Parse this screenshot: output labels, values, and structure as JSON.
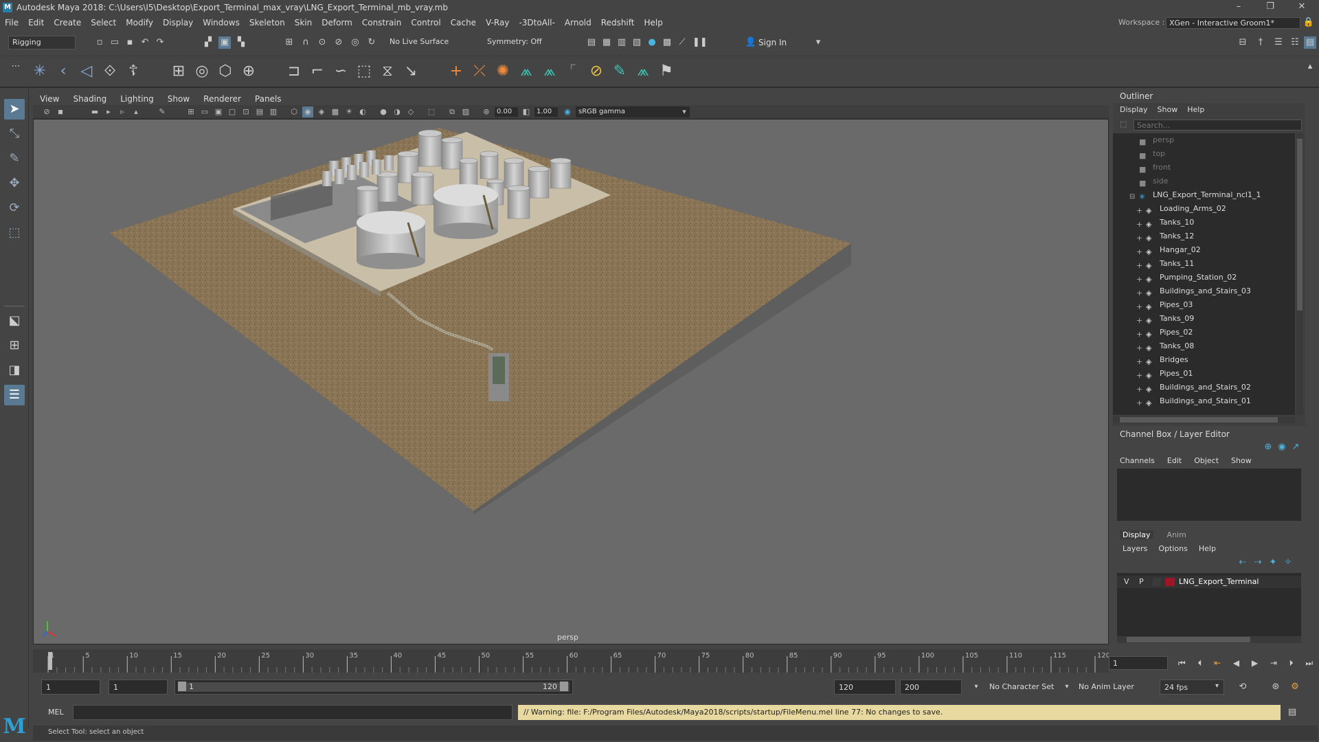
{
  "window": {
    "title": "Autodesk Maya 2018: C:\\Users\\I5\\Desktop\\Export_Terminal_max_vray\\LNG_Export_Terminal_mb_vray.mb"
  },
  "menubar": [
    "File",
    "Edit",
    "Create",
    "Select",
    "Modify",
    "Display",
    "Windows",
    "Skeleton",
    "Skin",
    "Deform",
    "Constrain",
    "Control",
    "Cache",
    "V-Ray",
    "-3DtoAll-",
    "Arnold",
    "Redshift",
    "Help"
  ],
  "workspace": {
    "label": "Workspace :",
    "value": "XGen - Interactive Groom1*"
  },
  "statusline": {
    "menuset": "Rigging",
    "live_surface": "No Live Surface",
    "symmetry": "Symmetry: Off",
    "sign_in": "Sign In"
  },
  "panel": {
    "menus": [
      "View",
      "Shading",
      "Lighting",
      "Show",
      "Renderer",
      "Panels"
    ],
    "exposure": "0.00",
    "gamma": "1.00",
    "colorspace": "sRGB gamma",
    "camera_label": "persp"
  },
  "outliner": {
    "title": "Outliner",
    "menus": [
      "Display",
      "Show",
      "Help"
    ],
    "search_placeholder": "Search...",
    "cameras": [
      "persp",
      "top",
      "front",
      "side"
    ],
    "root": "LNG_Export_Terminal_ncl1_1",
    "children": [
      "Loading_Arms_02",
      "Tanks_10",
      "Tanks_12",
      "Hangar_02",
      "Tanks_11",
      "Pumping_Station_02",
      "Buildings_and_Stairs_03",
      "Pipes_03",
      "Tanks_09",
      "Pipes_02",
      "Tanks_08",
      "Bridges",
      "Pipes_01",
      "Buildings_and_Stairs_02",
      "Buildings_and_Stairs_01"
    ]
  },
  "channelbox": {
    "title": "Channel Box / Layer Editor",
    "menus": [
      "Channels",
      "Edit",
      "Object",
      "Show"
    ]
  },
  "layers": {
    "tabs": [
      "Display",
      "Anim"
    ],
    "menus": [
      "Layers",
      "Options",
      "Help"
    ],
    "rows": [
      {
        "v": "V",
        "p": "P",
        "name": "LNG_Export_Terminal",
        "color": "#a01428"
      }
    ]
  },
  "timeline": {
    "ticks": [
      "1",
      "5",
      "10",
      "15",
      "20",
      "25",
      "30",
      "35",
      "40",
      "45",
      "50",
      "55",
      "60",
      "65",
      "70",
      "75",
      "80",
      "85",
      "90",
      "95",
      "100",
      "105",
      "110",
      "115",
      "120"
    ],
    "current_frame": "1"
  },
  "range": {
    "start": "1",
    "playback_start": "1",
    "slider_start": "1",
    "slider_end": "120",
    "playback_end": "120",
    "end": "200",
    "character_set": "No Character Set",
    "anim_layer": "No Anim Layer",
    "fps": "24 fps"
  },
  "cmdline": {
    "lang": "MEL",
    "message": "// Warning: file: F:/Program Files/Autodesk/Maya2018/scripts/startup/FileMenu.mel line 77: No changes to save."
  },
  "helpline": {
    "text": "Select Tool: select an object"
  },
  "colors": {
    "accent": "#5a7a94",
    "warning_bg": "#e8d9a0",
    "layer_red": "#a01428"
  }
}
